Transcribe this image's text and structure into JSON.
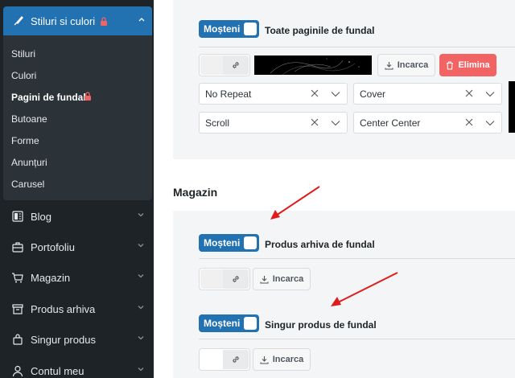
{
  "sidebar": {
    "active": {
      "label": "Stiluri si culori"
    },
    "submenu": [
      "Stiluri",
      "Culori",
      "Pagini de fundal",
      "Butoane",
      "Forme",
      "Anunțuri",
      "Carusel"
    ],
    "items": [
      {
        "label": "Blog",
        "icon": "blog-icon"
      },
      {
        "label": "Portofoliu",
        "icon": "briefcase-icon"
      },
      {
        "label": "Magazin",
        "icon": "cart-icon"
      },
      {
        "label": "Produs arhiva",
        "icon": "archive-icon"
      },
      {
        "label": "Singur produs",
        "icon": "bag-icon"
      },
      {
        "label": "Contul meu",
        "icon": "user-icon"
      }
    ]
  },
  "top_card": {
    "toggle_label": "Moșteni",
    "title": "Toate paginile de fundal",
    "upload_label": "Incarca",
    "delete_label": "Elimina",
    "repeat_value": "No Repeat",
    "size_value": "Cover",
    "attachment_value": "Scroll",
    "position_value": "Center Center"
  },
  "shop": {
    "section_title": "Magazin",
    "archive": {
      "toggle_label": "Moșteni",
      "title": "Produs arhiva de fundal",
      "upload_label": "Incarca"
    },
    "single": {
      "toggle_label": "Moșteni",
      "title": "Singur produs de fundal",
      "upload_label": "Incarca"
    }
  },
  "colors": {
    "accent": "#2271b1",
    "sidebar_bg": "#1d2327",
    "danger": "#f26464",
    "annotation_arrow": "#e01b1b"
  }
}
